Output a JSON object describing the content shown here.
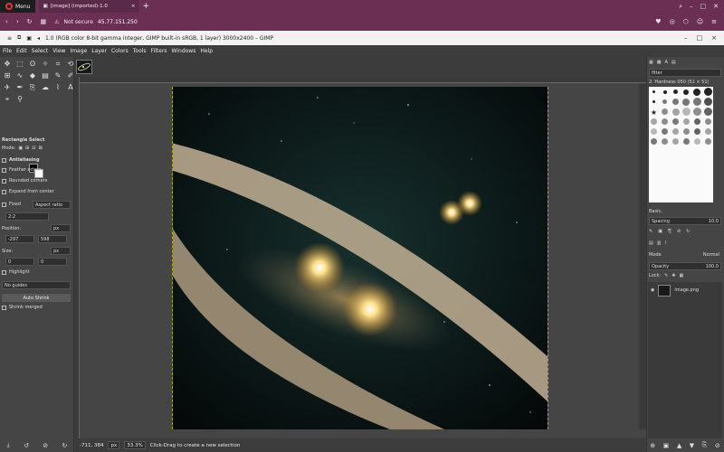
{
  "browser": {
    "menu_label": "Menu",
    "tab_title": "[image] (imported)-1.0",
    "new_tab": "+",
    "security_label": "Not secure",
    "url": "45.77.151.250",
    "app_title": "1.0 (RGB color 8-bit gamma integer, GIMP built-in sRGB, 1 layer) 3000x2400 – GIMP"
  },
  "menus": [
    "File",
    "Edit",
    "Select",
    "View",
    "Image",
    "Layer",
    "Colors",
    "Tools",
    "Filters",
    "Windows",
    "Help"
  ],
  "tool_options": {
    "title": "Rectangle Select",
    "mode_label": "Mode:",
    "antialiasing": "Antialiasing",
    "feather": "Feather edges",
    "rounded": "Rounded corners",
    "expand": "Expand from center",
    "fixed_label": "Fixed",
    "fixed_value": "Aspect ratio",
    "ratio": "2:2",
    "position_label": "Position:",
    "pos_x": "-297",
    "pos_y": "598",
    "size_label": "Size:",
    "size_w": "0",
    "size_h": "0",
    "unit": "px",
    "highlight": "Highlight",
    "guides": "No guides",
    "auto_shrink": "Auto Shrink",
    "shrink_merged": "Shrink merged"
  },
  "status": {
    "coords": "-711, 384",
    "unit": "px",
    "zoom": "33.3%",
    "message": "Click-Drag to create a new selection"
  },
  "brushes": {
    "filter_placeholder": "filter",
    "header": "2. Hardness 050 (51 × 51)",
    "tag": "Basic,",
    "spacing_label": "Spacing",
    "spacing_value": "10.0"
  },
  "layers": {
    "mode_label": "Mode",
    "mode_value": "Normal",
    "opacity_label": "Opacity",
    "opacity_value": "100.0",
    "lock_label": "Lock:",
    "layer_name": "image.png"
  }
}
